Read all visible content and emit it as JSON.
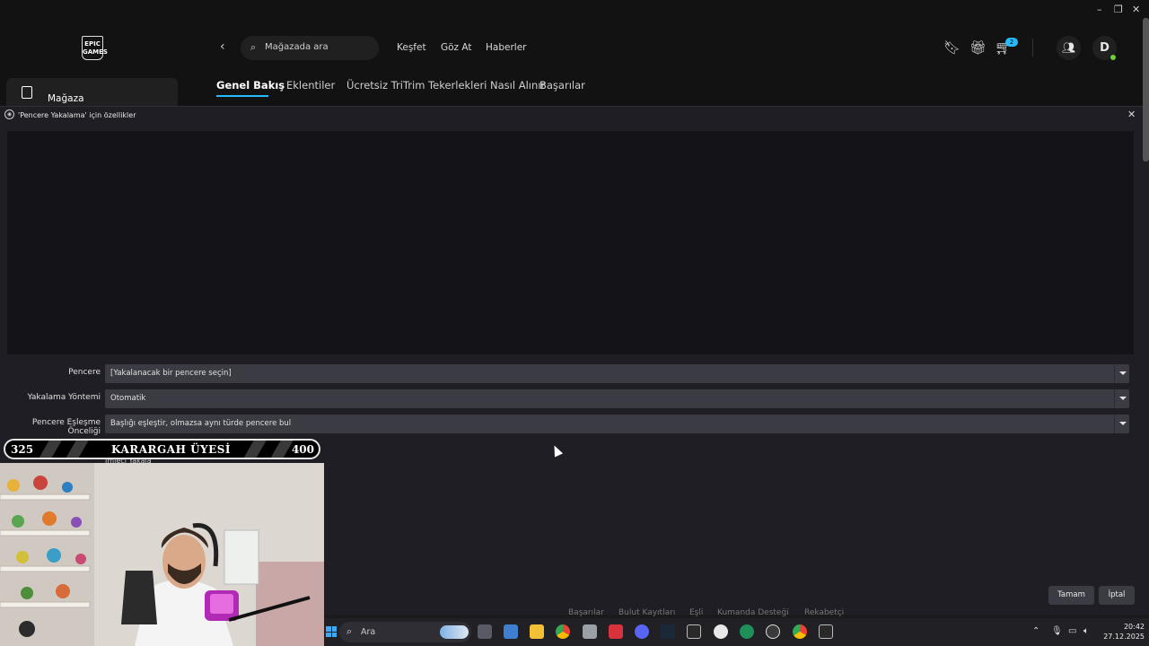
{
  "window_controls": {
    "minimize": "–",
    "restore": "❐",
    "close": "✕"
  },
  "epic": {
    "logo_text": "EPIC GAMES",
    "search_placeholder": "Mağazada ara",
    "nav": [
      "Keşfet",
      "Göz At",
      "Haberler"
    ],
    "cart_count": "2",
    "avatar_initial": "D",
    "sidebar_store_label": "Mağaza",
    "tabs": [
      "Genel Bakış",
      "Eklentiler",
      "Ücretsiz TriTrim Tekerlekleri Nasıl Alınır",
      "Başarılar"
    ]
  },
  "dialog": {
    "title": "'Pencere Yakalama' için özellikler",
    "properties": [
      {
        "label": "Pencere",
        "value": "[Yakalanacak bir pencere seçin]"
      },
      {
        "label": "Yakalama Yöntemi",
        "value": "Otomatik"
      },
      {
        "label": "Pencere Eşleşme Önceliği",
        "value": "Başlığı eşleştir, olmazsa aynı türde pencere bul"
      }
    ],
    "checkbox_label": "İmleci Yakala",
    "ok_label": "Tamam",
    "cancel_label": "İptal"
  },
  "underlying_tabs": [
    "Başarılar",
    "Bulut Kayıtları",
    "Eşli",
    "Kumanda Desteği",
    "Rekabetçi"
  ],
  "overlay": {
    "rank_left": "325",
    "rank_title": "KARARGAH ÜYESİ",
    "rank_right": "400"
  },
  "taskbar": {
    "search_label": "Ara",
    "time": "20:42",
    "date": "27.12.2025"
  }
}
